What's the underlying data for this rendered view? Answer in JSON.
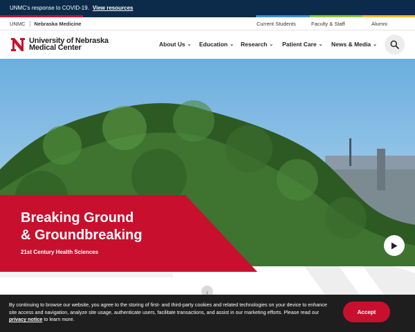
{
  "alert": {
    "text": "UNMC's response to COVID-19.",
    "link": "View resources"
  },
  "stripes": {
    "colors": [
      "#c8102e",
      "#0c2a4a",
      "#3f8fc8",
      "#8cc63e",
      "#f6b92b"
    ]
  },
  "utility": {
    "left": [
      "UNMC",
      "Nebraska Medicine"
    ],
    "right": [
      "Current Students",
      "Faculty & Staff",
      "Alumni"
    ]
  },
  "logo": {
    "line1": "University of Nebraska",
    "line2": "Medical Center",
    "icon": "unmc-n-logo"
  },
  "nav": {
    "items": [
      "About Us",
      "Education",
      "Research",
      "Patient Care",
      "News & Media"
    ],
    "search_icon": "search-icon"
  },
  "hero": {
    "title_line1": "Breaking Ground",
    "title_line2": "& Groundbreaking",
    "subtitle": "21st Century Health Sciences",
    "play_icon": "play-icon",
    "scroll_icon": "arrow-down-icon"
  },
  "cookie": {
    "text_before": "By continuing to browse our website, you agree to the storing of first- and third-party cookies and related technologies on your device to enhance site access and navigation, analyze site usage, authenticate users, facilitate transactions, and assist in our marketing efforts. Please read our",
    "link": "privacy notice",
    "text_after": "to learn more.",
    "accept": "Accept"
  },
  "colors": {
    "brand_red": "#c8102e",
    "navy": "#0c2a4a",
    "cookie_bg": "#1e1e1e"
  }
}
